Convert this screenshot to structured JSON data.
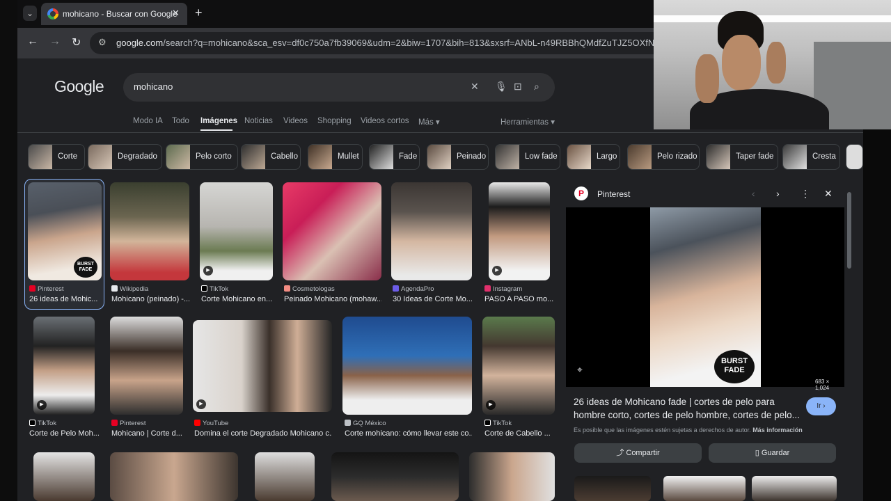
{
  "browser": {
    "tab_title": "mohicano - Buscar con Google",
    "url_domain": "google.com",
    "url_rest": "/search?q=mohicano&sca_esv=df0c750a7fb39069&udm=2&biw=1707&bih=813&sxsrf=ANbL-n49RBBhQMdfZuTJZ5OXfNoLm"
  },
  "google": {
    "logo": "Google",
    "query": "mohicano",
    "filters": [
      "Modo IA",
      "Todo",
      "Imágenes",
      "Noticias",
      "Videos",
      "Shopping",
      "Videos cortos",
      "Más ▾"
    ],
    "tools": "Herramientas ▾"
  },
  "chips": [
    "Corte",
    "Degradado",
    "Pelo corto",
    "Cabello",
    "Mullet",
    "Fade",
    "Peinado",
    "Low fade",
    "Largo",
    "Pelo rizado",
    "Taper fade",
    "Cresta"
  ],
  "results": [
    {
      "source": "Pinterest",
      "title": "26 ideas de Mohic...",
      "overlay": "BURST FADE"
    },
    {
      "source": "Wikipedia",
      "title": "Mohicano (peinado) -..."
    },
    {
      "source": "TikTok",
      "title": "Corte Mohicano en..."
    },
    {
      "source": "Cosmetologas",
      "title": "Peinado Mohicano (mohaw..."
    },
    {
      "source": "AgendaPro",
      "title": "30 Ideas de Corte Mo..."
    },
    {
      "source": "Instagram",
      "title": "PASO A PASO mo..."
    },
    {
      "source": "TikTok",
      "title": "Corte de Pelo Moh..."
    },
    {
      "source": "Pinterest",
      "title": "Mohicano | Corte d..."
    },
    {
      "source": "YouTube",
      "title": "Domina el corte Degradado Mohicano c..."
    },
    {
      "source": "GQ México",
      "title": "Corte mohicano: cómo llevar este co..."
    },
    {
      "source": "TikTok",
      "title": "Corte de Cabello ..."
    }
  ],
  "panel": {
    "source": "Pinterest",
    "image_overlay": "BURST FADE",
    "dimensions": "683 × 1,024",
    "title": "26 ideas de Mohicano fade | cortes de pelo para hombre corto, cortes de pelo hombre, cortes de pelo...",
    "go_label": "Ir ›",
    "note": "Es posible que las imágenes estén sujetas a derechos de autor.",
    "note_link": "Más información",
    "share_label": "Compartir",
    "save_label": "Guardar"
  },
  "colors": {
    "accent": "#8ab4f8",
    "background": "#202124",
    "pinterest": "#e60023"
  }
}
